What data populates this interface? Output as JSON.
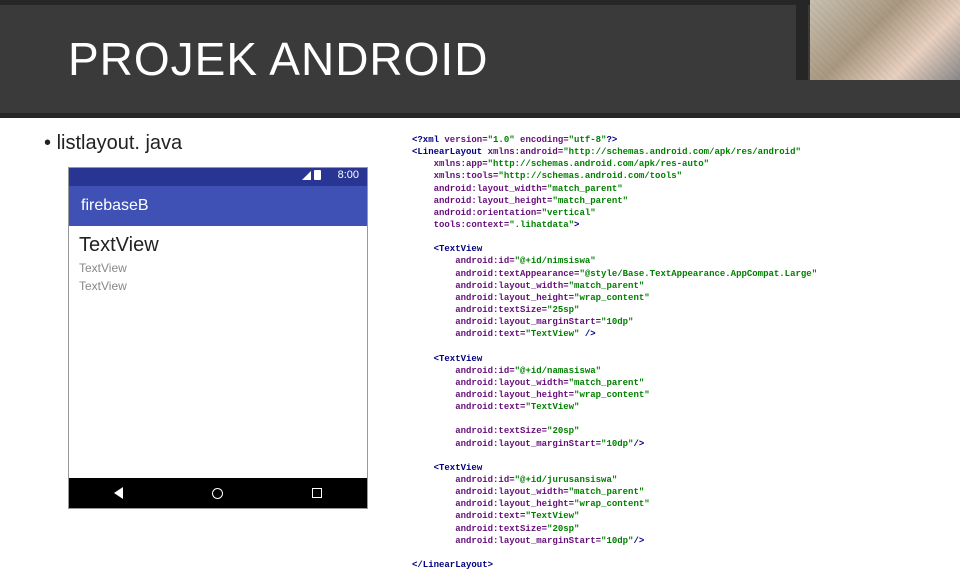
{
  "header": {
    "title": "PROJEK ANDROID"
  },
  "bullet": {
    "text": "listlayout. java"
  },
  "phone": {
    "time": "8:00",
    "app_title": "firebaseB",
    "tv1": "TextView",
    "tv2": "TextView",
    "tv3": "TextView"
  },
  "code": {
    "decl_open": "<?xml ",
    "decl_a1": "version=",
    "decl_v1": "\"1.0\"",
    "decl_a2": " encoding=",
    "decl_v2": "\"utf-8\"",
    "decl_close": "?>",
    "ll_open": "<LinearLayout ",
    "ll_a1": "xmlns:android=",
    "ll_v1": "\"http://schemas.android.com/apk/res/android\"",
    "ll_a2": "xmlns:app=",
    "ll_v2": "\"http://schemas.android.com/apk/res-auto\"",
    "ll_a3": "xmlns:tools=",
    "ll_v3": "\"http://schemas.android.com/tools\"",
    "ll_a4": "android:layout_width=",
    "ll_v4": "\"match_parent\"",
    "ll_a5": "android:layout_height=",
    "ll_v5": "\"match_parent\"",
    "ll_a6": "android:orientation=",
    "ll_v6": "\"vertical\"",
    "ll_a7": "tools:context=",
    "ll_v7": "\".lihatdata\"",
    "tv_open": "<TextView",
    "tA_a1": "android:id=",
    "tA_v1": "\"@+id/nimsiswa\"",
    "tA_a2": "android:textAppearance=",
    "tA_v2": "\"@style/Base.TextAppearance.AppCompat.Large\"",
    "tA_a3": "android:layout_width=",
    "tA_v3": "\"match_parent\"",
    "tA_a4": "android:layout_height=",
    "tA_v4": "\"wrap_content\"",
    "tA_a5": "android:textSize=",
    "tA_v5": "\"25sp\"",
    "tA_a6": "android:layout_marginStart=",
    "tA_v6": "\"10dp\"",
    "tA_a7": "android:text=",
    "tA_v7": "\"TextView\"",
    "tB_a1": "android:id=",
    "tB_v1": "\"@+id/namasiswa\"",
    "tB_a2": "android:layout_width=",
    "tB_v2": "\"match_parent\"",
    "tB_a3": "android:layout_height=",
    "tB_v3": "\"wrap_content\"",
    "tB_a4": "android:text=",
    "tB_v4": "\"TextView\"",
    "tB_a5": "android:textSize=",
    "tB_v5": "\"20sp\"",
    "tB_a6": "android:layout_marginStart=",
    "tB_v6": "\"10dp\"",
    "tC_a1": "android:id=",
    "tC_v1": "\"@+id/jurusansiswa\"",
    "tC_a2": "android:layout_width=",
    "tC_v2": "\"match_parent\"",
    "tC_a3": "android:layout_height=",
    "tC_v3": "\"wrap_content\"",
    "tC_a4": "android:text=",
    "tC_v4": "\"TextView\"",
    "tC_a5": "android:textSize=",
    "tC_v5": "\"20sp\"",
    "tC_a6": "android:layout_marginStart=",
    "tC_v6": "\"10dp\"",
    "ll_close": "</LinearLayout>",
    "sc1": " />",
    "sc2": "/>",
    "gt": ">"
  }
}
